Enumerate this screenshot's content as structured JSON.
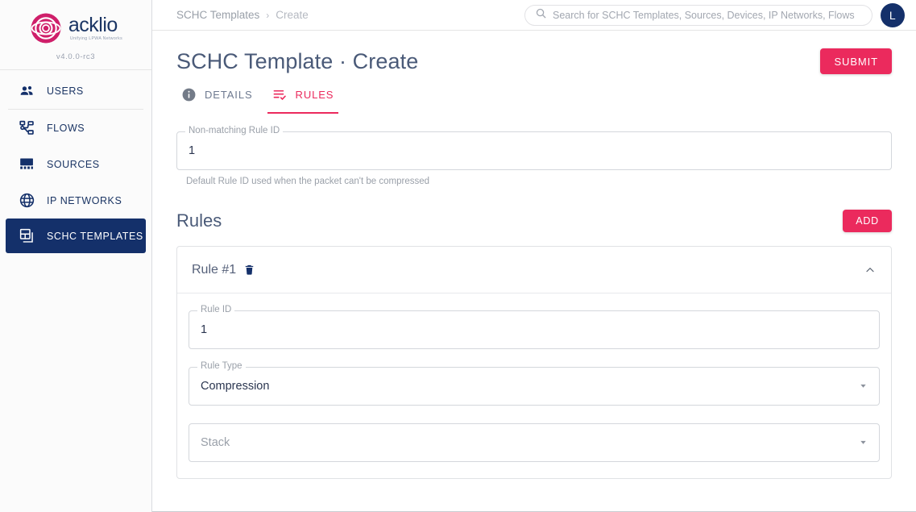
{
  "brand": {
    "name": "acklio",
    "tagline": "Unifying LPWA Networks",
    "version": "v4.0.0-rc3",
    "logo_icon": "acklio-logo-icon"
  },
  "sidebar": {
    "items": [
      {
        "label": "USERS",
        "icon": "users-icon",
        "active": false
      },
      {
        "label": "FLOWS",
        "icon": "flows-icon",
        "active": false
      },
      {
        "label": "SOURCES",
        "icon": "sources-icon",
        "active": false
      },
      {
        "label": "IP NETWORKS",
        "icon": "globe-icon",
        "active": false
      },
      {
        "label": "SCHC TEMPLATES",
        "icon": "schc-templates-icon",
        "active": true
      }
    ]
  },
  "topbar": {
    "breadcrumb": {
      "parent": "SCHC Templates",
      "separator": "›",
      "current": "Create"
    },
    "search": {
      "placeholder": "Search for SCHC Templates, Sources, Devices, IP Networks, Flows",
      "value": "",
      "icon": "search-icon"
    },
    "avatar": {
      "initial": "L"
    }
  },
  "page": {
    "title": "SCHC Template · Create",
    "submit_label": "SUBMIT"
  },
  "tabs": [
    {
      "label": "DETAILS",
      "icon": "info-icon",
      "active": false
    },
    {
      "label": "RULES",
      "icon": "rules-checklist-icon",
      "active": true
    }
  ],
  "form": {
    "non_matching_rule_id": {
      "label": "Non-matching Rule ID",
      "value": "1",
      "hint": "Default Rule ID used when the packet can't be compressed"
    }
  },
  "rules_section": {
    "title": "Rules",
    "add_label": "ADD",
    "panels": [
      {
        "title": "Rule #1",
        "delete_icon": "trash-icon",
        "collapse_icon": "chevron-up-icon",
        "expanded": true,
        "fields": {
          "rule_id": {
            "label": "Rule ID",
            "value": "1"
          },
          "rule_type": {
            "label": "Rule Type",
            "value": "Compression",
            "arrow_icon": "chevron-down-icon"
          },
          "stack": {
            "label": "",
            "placeholder": "Stack",
            "value": "",
            "arrow_icon": "chevron-down-icon"
          }
        }
      }
    ]
  },
  "colors": {
    "accent_pink": "#eb2a5d",
    "navy": "#14306a",
    "title_gray": "#4a5a78",
    "muted": "#9aa0a9"
  }
}
